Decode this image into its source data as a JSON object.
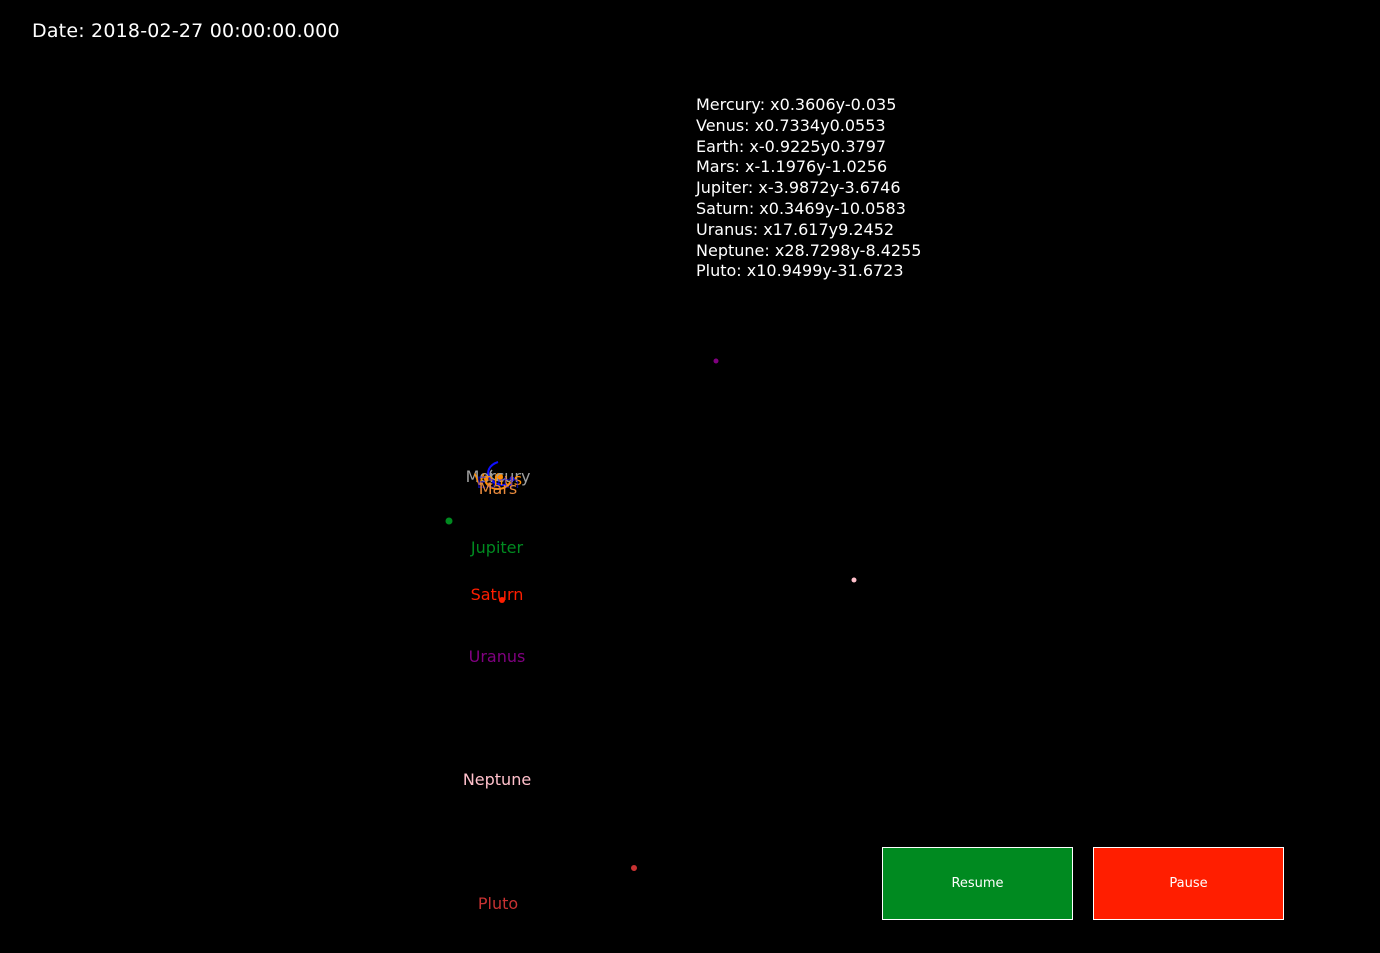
{
  "date_readout": "Date: 2018-02-27 00:00:00.000",
  "coordinates": [
    {
      "planet": "Mercury",
      "text": "Mercury: x0.3606y-0.035"
    },
    {
      "planet": "Venus",
      "text": "Venus: x0.7334y0.0553"
    },
    {
      "planet": "Earth",
      "text": "Earth: x-0.9225y0.3797"
    },
    {
      "planet": "Mars",
      "text": "Mars: x-1.1976y-1.0256"
    },
    {
      "planet": "Jupiter",
      "text": "Jupiter: x-3.9872y-3.6746"
    },
    {
      "planet": "Saturn",
      "text": "Saturn: x0.3469y-10.0583"
    },
    {
      "planet": "Uranus",
      "text": "Uranus: x17.617y9.2452"
    },
    {
      "planet": "Neptune",
      "text": "Neptune: x28.7298y-8.4255"
    },
    {
      "planet": "Pluto",
      "text": "Pluto: x10.9499y-31.6723"
    }
  ],
  "legend_labels": {
    "mercury": "Mercury",
    "venus": "Venus",
    "earth": "Earth",
    "mars": "Mars",
    "jupiter": "Jupiter",
    "saturn": "Saturn",
    "uranus": "Uranus",
    "neptune": "Neptune",
    "pluto": "Pluto"
  },
  "colors": {
    "background": "#000000",
    "mercury": "#a0a0a0",
    "venus": "#ff8c00",
    "earth": "#1010ff",
    "mars": "#e88a3c",
    "jupiter": "#008a20",
    "saturn": "#ff1e00",
    "uranus": "#800080",
    "neptune": "#ffc0cb",
    "pluto": "#c83232",
    "resume_button": "#008a20",
    "pause_button": "#ff1e00"
  },
  "buttons": {
    "resume_label": "Resume",
    "pause_label": "Pause"
  }
}
